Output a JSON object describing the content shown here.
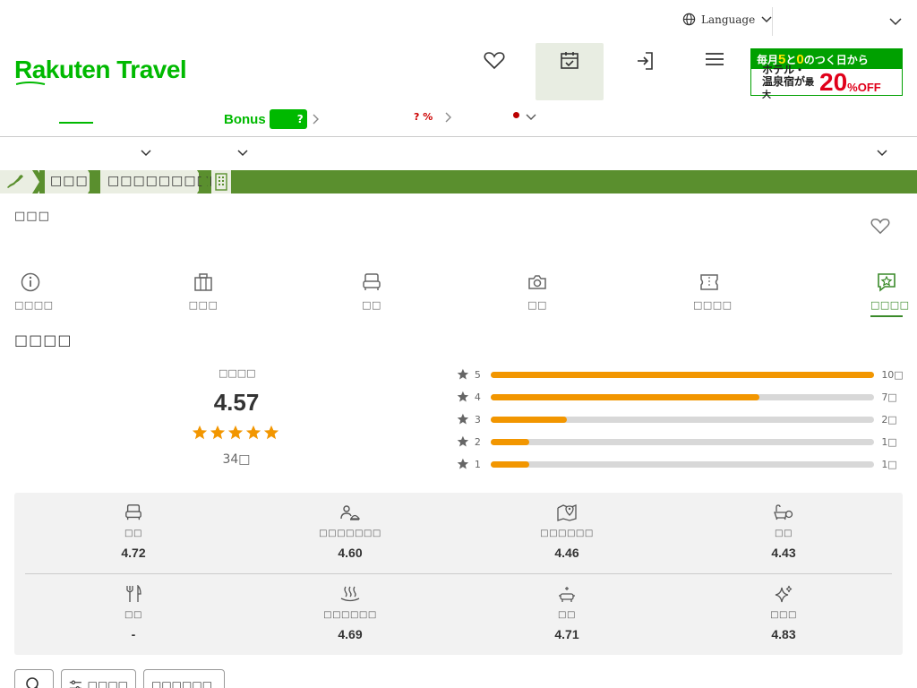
{
  "topbar": {
    "language_label": "Language"
  },
  "header": {
    "logo_text": "Rakuten Travel",
    "icons": [
      "heart-icon",
      "calendar-check-icon",
      "login-icon",
      "hamburger-menu-icon"
    ],
    "banner": {
      "line1_a": "毎月",
      "line1_b": "5",
      "line1_c": "と",
      "line1_d": "0",
      "line1_e": "のつく日から",
      "line2_a": "ホテル・",
      "line2_b": "温泉宿が",
      "line2_c": "最大",
      "percent": "20",
      "percent_sign": "%",
      "off": "OFF"
    }
  },
  "subnav": {
    "bonus_label": "Bonus",
    "bonus_badge": "?",
    "pct_label": "? %"
  },
  "breadcrumb": {
    "items": [
      "□□□",
      "□□□□□□□□□"
    ]
  },
  "hotel": {
    "name": "□□□"
  },
  "tabs": [
    {
      "label": "□□□□",
      "icon": "info-icon"
    },
    {
      "label": "□□□",
      "icon": "building-icon"
    },
    {
      "label": "□□",
      "icon": "bed-icon"
    },
    {
      "label": "□□",
      "icon": "camera-icon"
    },
    {
      "label": "□□□□",
      "icon": "ticket-icon"
    },
    {
      "label": "□□□□",
      "icon": "review-star-icon"
    }
  ],
  "reviews": {
    "section_title": "□□□□",
    "overall_label": "□□□□",
    "overall_score": "4.57",
    "star_rating": 4.57,
    "review_count": "34□",
    "distribution": [
      {
        "stars": "5",
        "count": "10□",
        "fraction": 1.0
      },
      {
        "stars": "4",
        "count": "7□",
        "fraction": 0.7
      },
      {
        "stars": "3",
        "count": "2□",
        "fraction": 0.2
      },
      {
        "stars": "2",
        "count": "1□",
        "fraction": 0.1
      },
      {
        "stars": "1",
        "count": "1□",
        "fraction": 0.1
      }
    ],
    "categories": [
      {
        "label": "□□",
        "value": "4.72",
        "icon": "bed-icon"
      },
      {
        "label": "□□□□□□□",
        "value": "4.60",
        "icon": "service-icon"
      },
      {
        "label": "□□□□□□",
        "value": "4.46",
        "icon": "map-pin-icon"
      },
      {
        "label": "□□",
        "value": "4.43",
        "icon": "bath-icon"
      },
      {
        "label": "□□",
        "value": "-",
        "icon": "fork-knife-icon"
      },
      {
        "label": "□□□□□□",
        "value": "4.69",
        "icon": "hot-spring-icon"
      },
      {
        "label": "□□",
        "value": "4.71",
        "icon": "amenity-icon"
      },
      {
        "label": "□□□",
        "value": "4.83",
        "icon": "sparkle-icon"
      }
    ]
  },
  "controls": {
    "filter_label": "□□□□",
    "sort_label": "□□□□□□"
  }
}
